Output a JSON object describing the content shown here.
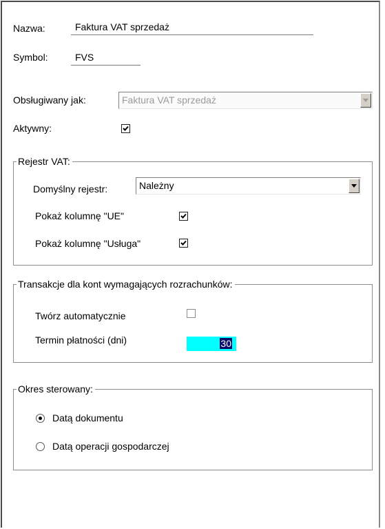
{
  "form": {
    "nazwa_label": "Nazwa:",
    "nazwa_value": "Faktura VAT sprzedaż",
    "symbol_label": "Symbol:",
    "symbol_value": "FVS",
    "obslugiwany_label": "Obsługiwany jak:",
    "obslugiwany_value": "Faktura VAT sprzedaż",
    "aktywny_label": "Aktywny:",
    "aktywny_checked": true
  },
  "rejestr_vat": {
    "title": "Rejestr VAT:",
    "domyslny_label": "Domyślny rejestr:",
    "domyslny_value": "Należny",
    "ue_label": "Pokaż kolumnę \"UE\"",
    "ue_checked": true,
    "usluga_label": "Pokaż kolumnę \"Usługa\"",
    "usluga_checked": true
  },
  "transakcje": {
    "title": "Transakcje dla kont wymagających rozrachunków:",
    "tworz_label": "Twórz automatycznie",
    "tworz_checked": false,
    "termin_label": "Termin płatności (dni)",
    "termin_value": "30"
  },
  "okres": {
    "title": "Okres sterowany:",
    "options": [
      {
        "label": "Datą dokumentu",
        "selected": true
      },
      {
        "label": "Datą operacji gospodarczej",
        "selected": false
      }
    ]
  },
  "colors": {
    "highlight_field": "#00ffff",
    "selection": "#0a0a6a"
  }
}
